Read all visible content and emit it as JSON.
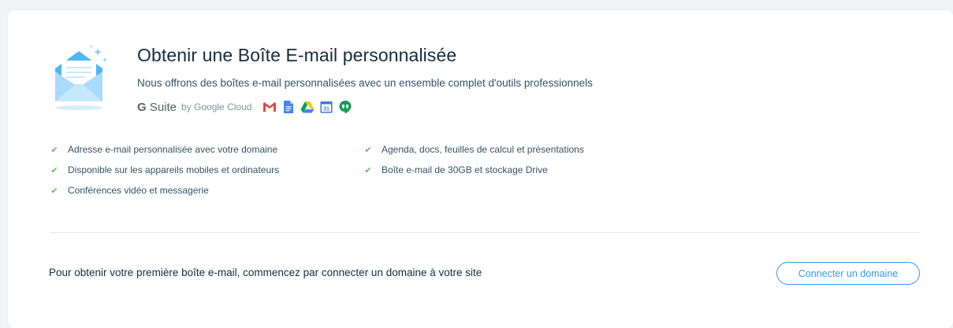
{
  "header": {
    "title": "Obtenir une Boîte E-mail personnalisée",
    "subtitle": "Nous offrons des boîtes e-mail personnalisées avec un ensemble complet d'outils professionnels"
  },
  "gsuite": {
    "brand_g": "G",
    "brand_suite": " Suite",
    "by": "by Google Cloud",
    "apps": [
      "gmail-icon",
      "docs-icon",
      "drive-icon",
      "calendar-icon",
      "hangouts-icon"
    ],
    "calendar_number": "31"
  },
  "features": {
    "left": [
      "Adresse e-mail personnalisée avec votre domaine",
      "Disponible sur les appareils mobiles et ordinateurs",
      "Conférences vidéo et messagerie"
    ],
    "right": [
      "Agenda, docs, feuilles de calcul et présentations",
      "Boîte e-mail de 30GB et stockage Drive"
    ]
  },
  "cta": {
    "text": "Pour obtenir votre première boîte e-mail, commencez par connecter un domaine à votre site",
    "button_label": "Connecter un domaine"
  },
  "colors": {
    "accent": "#3899ec",
    "check": "#60bc57",
    "text_primary": "#162d3d",
    "text_secondary": "#32536a"
  }
}
